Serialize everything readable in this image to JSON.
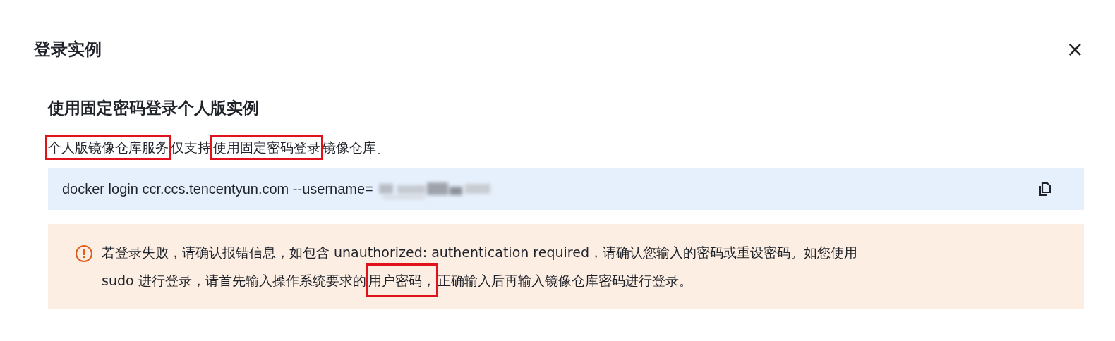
{
  "dialog": {
    "title": "登录实例",
    "close": "×"
  },
  "section": {
    "heading": "使用固定密码登录个人版实例",
    "description": [
      {
        "text": "个人版镜像仓库服务",
        "boxed": true
      },
      {
        "text": "仅支持",
        "boxed": false
      },
      {
        "text": "使用固定密码登录",
        "boxed": true
      },
      {
        "text": "镜像仓库。",
        "boxed": false
      }
    ],
    "command": "docker login ccr.ccs.tencentyun.com --username=",
    "warning_lines": [
      [
        {
          "text": "若登录失败，请确认报错信息，如包含 unauthorized: authentication required，请确认您输入的密码或重设密码。如您使用",
          "boxed": false
        }
      ],
      [
        {
          "text": "sudo 进行登录，请首先输入操作系统要求的",
          "boxed": false
        },
        {
          "text": "用户密码，",
          "boxed": true
        },
        {
          "text": "正确输入后再输入镜像仓库密码进行登录。",
          "boxed": false
        }
      ]
    ]
  }
}
